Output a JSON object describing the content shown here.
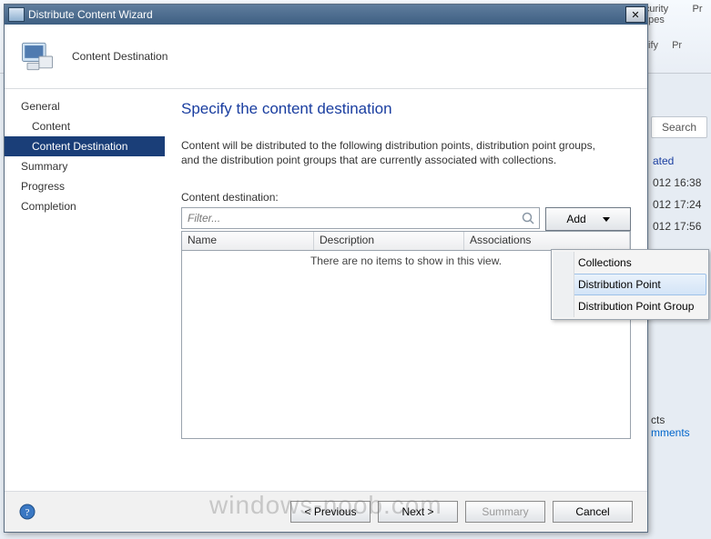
{
  "background": {
    "ribbon": {
      "group1_l1": "curity",
      "group1_l2": "pes",
      "group2_l1": "Pr",
      "classify": "ssify",
      "classify2": "Pr"
    },
    "search_label": "Search",
    "column_header": "ated",
    "rows": [
      "012 16:38",
      "012 17:24",
      "012 17:56"
    ],
    "links_header": "cts",
    "link": "mments"
  },
  "wizard": {
    "title": "Distribute Content Wizard",
    "header": "Content Destination",
    "nav": [
      "General",
      "Content",
      "Content Destination",
      "Summary",
      "Progress",
      "Completion"
    ],
    "nav_selected": 2,
    "page_title": "Specify the content destination",
    "description": "Content will be distributed to the following distribution points, distribution point groups, and the distribution point groups that are currently associated with collections.",
    "list_label": "Content destination:",
    "filter_placeholder": "Filter...",
    "add_label": "Add",
    "columns": [
      "Name",
      "Description",
      "Associations"
    ],
    "empty_msg": "There are no items to show in this view.",
    "buttons": {
      "previous": "< Previous",
      "next": "Next >",
      "summary": "Summary",
      "cancel": "Cancel"
    },
    "menu": [
      "Collections",
      "Distribution Point",
      "Distribution Point Group"
    ],
    "menu_hover": 1
  },
  "watermark": "windows-noob.com"
}
